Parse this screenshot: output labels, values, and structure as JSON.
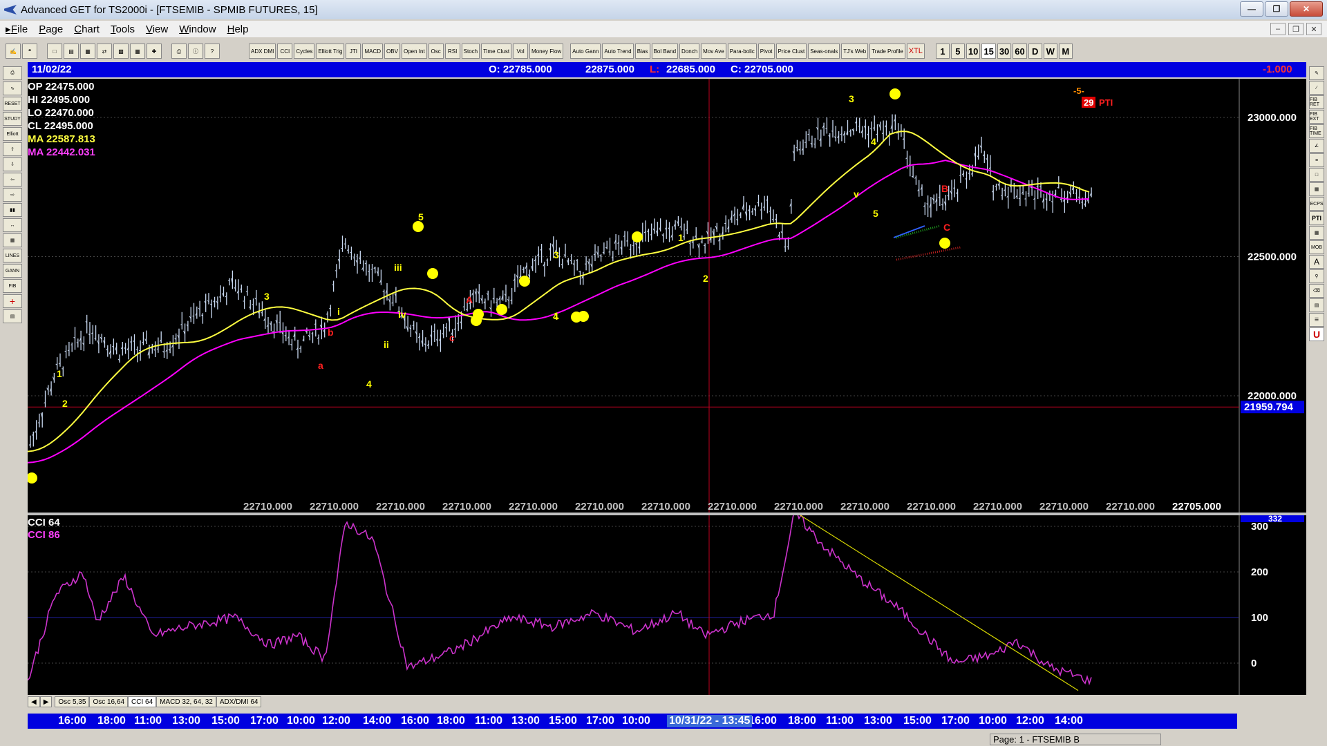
{
  "window": {
    "title": "Advanced GET for TS2000i - [FTSEMIB - SPMIB FUTURES, 15]",
    "buttons": [
      "—",
      "❐",
      "✕"
    ]
  },
  "menu": [
    "File",
    "Page",
    "Chart",
    "Tools",
    "View",
    "Window",
    "Help"
  ],
  "toolbar": {
    "studies": [
      "ADX DMI",
      "CCI",
      "Cycles",
      "Elliott Trig",
      "JTI",
      "MACD",
      "OBV",
      "Open Int",
      "Osc",
      "RSI",
      "Stoch",
      "Time Clust",
      "Vol",
      "Money Flow"
    ],
    "studies2": [
      "Auto Gann",
      "Auto Trend",
      "Bias",
      "Bol Band",
      "Donch",
      "Mov Ave",
      "Para-bolic",
      "Pivot",
      "Price Clust",
      "Seas-onals",
      "TJ's Web",
      "Trade Profile",
      "XTL"
    ],
    "intervals": [
      "1",
      "5",
      "10",
      "15",
      "30",
      "60",
      "D",
      "W",
      "M"
    ],
    "active_interval": "15"
  },
  "info": {
    "date": "11/02/22",
    "open": "O: 22785.000",
    "high": "22875.000",
    "low_label": "L:",
    "low": "22685.000",
    "close": "C: 22705.000",
    "change": "-1.000"
  },
  "readout": {
    "op": "OP  22475.000",
    "hi": "HI   22495.000",
    "lo": "LO  22470.000",
    "cl": "CL  22495.000",
    "ma1": "MA  22587.813",
    "ma2": "MA  22442.031"
  },
  "price_axis": {
    "labels": [
      "23000.000",
      "22500.000",
      "22000.000"
    ],
    "cursor": "21959.794"
  },
  "bottom_values": [
    "22710.000",
    "22710.000",
    "22710.000",
    "22710.000",
    "22710.000",
    "22710.000",
    "22710.000",
    "22710.000",
    "22710.000",
    "22710.000",
    "22710.000",
    "22710.000",
    "22710.000",
    "22710.000",
    "22705.000"
  ],
  "pti": {
    "label": "-5-",
    "value": "29",
    "name": "PTI"
  },
  "cci": {
    "title": "CCI 64",
    "title2": "CCI  86",
    "axis_labels": [
      "300",
      "200",
      "100",
      "0"
    ],
    "top_label": "332"
  },
  "osc_tabs": [
    "Osc 5,35",
    "Osc 16,64",
    "CCI 64",
    "MACD 32, 64, 32",
    "ADX/DMI 64"
  ],
  "active_osc_tab": "CCI 64",
  "time_axis": {
    "labels": [
      "16:00",
      "18:00",
      "11:00",
      "13:00",
      "15:00",
      "17:00",
      "10:00",
      "12:00",
      "14:00",
      "16:00",
      "18:00",
      "11:00",
      "13:00",
      "15:00",
      "17:00",
      "10:00",
      "16:00",
      "18:00",
      "11:00",
      "13:00",
      "15:00",
      "17:00",
      "10:00",
      "12:00",
      "14:00"
    ],
    "cursor": "10/31/22 - 13:45"
  },
  "elliott_labels": [
    {
      "t": "1",
      "c": "#ffff00"
    },
    {
      "t": "2",
      "c": "#ffff00"
    },
    {
      "t": "3",
      "c": "#ffff00"
    },
    {
      "t": "4",
      "c": "#ffff00"
    },
    {
      "t": "5",
      "c": "#ffff00"
    },
    {
      "t": "a",
      "c": "#ff2020"
    },
    {
      "t": "b",
      "c": "#ff2020"
    },
    {
      "t": "c",
      "c": "#ff2020"
    },
    {
      "t": "A",
      "c": "#ff2020"
    },
    {
      "t": "B",
      "c": "#ff2020"
    },
    {
      "t": "C",
      "c": "#ff2020"
    },
    {
      "t": "i",
      "c": "#ffff00"
    },
    {
      "t": "ii",
      "c": "#ffff00"
    },
    {
      "t": "iii",
      "c": "#ffff00"
    },
    {
      "t": "iv",
      "c": "#ffff00"
    },
    {
      "t": "v",
      "c": "#ffff00"
    }
  ],
  "statusbar": {
    "page": "Page: 1 - FTSEMIB B"
  },
  "colors": {
    "ma_fast": "#ffff40",
    "ma_slow": "#ff00ff",
    "bars": "#c8d8f0",
    "cci": "#cc33cc",
    "axis_bar": "#0000e0"
  }
}
